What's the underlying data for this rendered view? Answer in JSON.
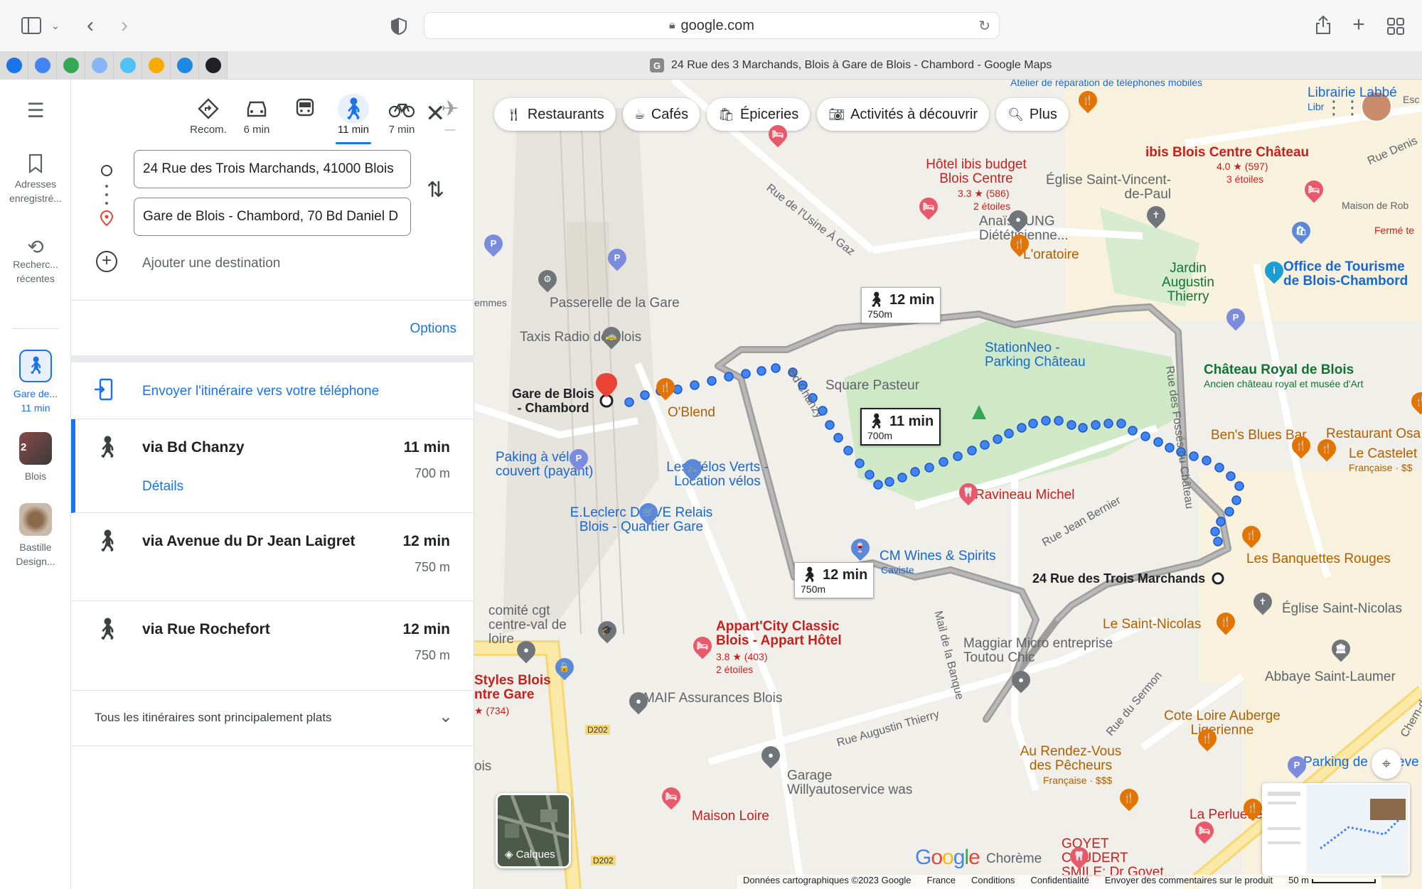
{
  "browser": {
    "url": "google.com",
    "tab_title": "24 Rue des 3 Marchands, Blois à Gare de Blois - Chambord - Google Maps",
    "tab_favicon": "G",
    "pinned_tabs": [
      "#1a73e8",
      "#4285f4",
      "#34a853",
      "#8ab4f8",
      "#4fc3f7",
      "#f9ab00",
      "#1e88e5",
      "#202124"
    ]
  },
  "rail": {
    "saved_label": "Adresses enregistré...",
    "recent_label": "Recherc... récentes",
    "recent_item_label": "Gare de...",
    "recent_item_time": "11 min",
    "blois_label": "Blois",
    "blois_badge": "2",
    "bastille_label": "Bastille Design..."
  },
  "modes": [
    {
      "name": "recommended",
      "label": "Recom."
    },
    {
      "name": "car",
      "label": "6 min"
    },
    {
      "name": "transit",
      "label": ""
    },
    {
      "name": "walk",
      "label": "11 min"
    },
    {
      "name": "bike",
      "label": "7 min"
    },
    {
      "name": "flight",
      "label": "—"
    }
  ],
  "waypoints": {
    "origin": "24 Rue des Trois Marchands, 41000 Blois",
    "destination": "Gare de Blois - Chambord, 70 Bd Daniel D",
    "add_destination": "Ajouter une destination"
  },
  "options_label": "Options",
  "send_to_phone": "Envoyer l'itinéraire vers votre téléphone",
  "routes": [
    {
      "via": "via Bd Chanzy",
      "time": "11 min",
      "distance": "700 m",
      "details": "Détails"
    },
    {
      "via": "via Avenue du Dr Jean Laigret",
      "time": "12 min",
      "distance": "750 m"
    },
    {
      "via": "via Rue Rochefort",
      "time": "12 min",
      "distance": "750 m"
    }
  ],
  "flat_note": "Tous les itinéraires sont principalement plats",
  "map": {
    "chips": [
      "Restaurants",
      "Cafés",
      "Épiceries",
      "Activités à découvrir",
      "Plus"
    ],
    "route_boxes": [
      {
        "time": "12 min",
        "dist": "750m"
      },
      {
        "time": "11 min",
        "dist": "700m"
      },
      {
        "time": "12 min",
        "dist": "750m"
      }
    ],
    "labels": {
      "gare": "Gare de Blois - Chambord",
      "start": "24 Rue des Trois Marchands",
      "passerelle": "Passerelle de la Gare",
      "taxis": "Taxis Radio de Blois",
      "oblend": "O'Blend",
      "paking": "Paking à vélo couvert (payant)",
      "velos": "Les Vélos Verts - Location vélos",
      "leclerc": "E.Leclerc DRIVE Relais Blois - Quartier Gare",
      "comite": "comité cgt centre-val de loire",
      "appart": "Appart'City Classic Blois - Appart Hôtel",
      "appart_rating": "3.8 ★ (403)",
      "appart_stars": "2 étoiles",
      "styles": "Styles Blois ntre Gare",
      "styles_rating": "★ (734)",
      "maif": "MAIF Assurances Blois",
      "maison_loire": "Maison Loire",
      "garage": "Garage Willyautoservice was",
      "cm_wines": "CM Wines & Spirits",
      "caviste": "Caviste",
      "ravineau": "Ravineau Michel",
      "square": "Square Pasteur",
      "stationeo": "StationNeo - Parking Château",
      "ibis_budget": "Hôtel ibis budget Blois Centre",
      "ibis_budget_rating": "3.3 ★ (586)",
      "ibis_budget_stars": "2 étoiles",
      "ibis_centre": "ibis Blois Centre Château",
      "ibis_centre_rating": "4.0 ★ (597)",
      "ibis_centre_stars": "3 étoiles",
      "eglise_svp": "Église Saint-Vincent-de-Paul",
      "anais": "Anaïs LUNG Diététicienne...",
      "oratoire": "L'oratoire",
      "jardin": "Jardin Augustin Thierry",
      "office": "Office de Tourisme de Blois-Chambord",
      "chateau": "Château Royal de Blois",
      "chateau_sub": "Ancien château royal et musée d'Art",
      "bens": "Ben's Blues Bar",
      "restaurant_osa": "Restaurant Osa",
      "castelet": "Le Castelet",
      "castelet_sub": "Française · $$",
      "banquettes": "Les Banquettes Rouges",
      "saint_nicolas": "Le Saint-Nicolas",
      "eglise_sn": "Église Saint-Nicolas",
      "abbaye": "Abbaye Saint-Laumer",
      "maggiar": "Maggiar Micro entreprise Toutou Chic",
      "cote_loire": "Cote Loire Auberge Ligerienne",
      "rendez_vous": "Au Rendez-Vous des Pêcheurs",
      "rendez_vous_sub": "Française · $$$",
      "perluette": "La Perluette",
      "goyet": "GOYET COUDERT SMILE: Dr Goyet...",
      "chorème": "Chorème",
      "parking_de": "Parking de",
      "librairie": "Librairie Labbé",
      "maison_rob": "Maison de Rob",
      "ferme": "Fermé te",
      "atelier": "Atelier de réparation de téléphones mobiles",
      "rue_usine": "Rue de l'Usine À Gaz",
      "bd_chanzy": "Bd Chanzy",
      "rue_fosses": "Rue des Fossés du Château",
      "rue_bernier": "Rue Jean Bernier",
      "rue_thierry": "Rue Augustin Thierry",
      "rue_sermon": "Rue du Sermon",
      "mail_banque": "Mail de la Banque",
      "rue_denis": "Rue Denis",
      "d202": "D202",
      "emmes": "emmes",
      "ois": "ois",
      "eve": "eve",
      "chem": "Chem-de-H",
      "esc": "Esc",
      "dlibr": "Libr"
    },
    "layers_label": "Calques",
    "footer": [
      "Données cartographiques ©2023 Google",
      "France",
      "Conditions",
      "Confidentialité",
      "Envoyer des commentaires sur le produit",
      "50 m"
    ]
  }
}
